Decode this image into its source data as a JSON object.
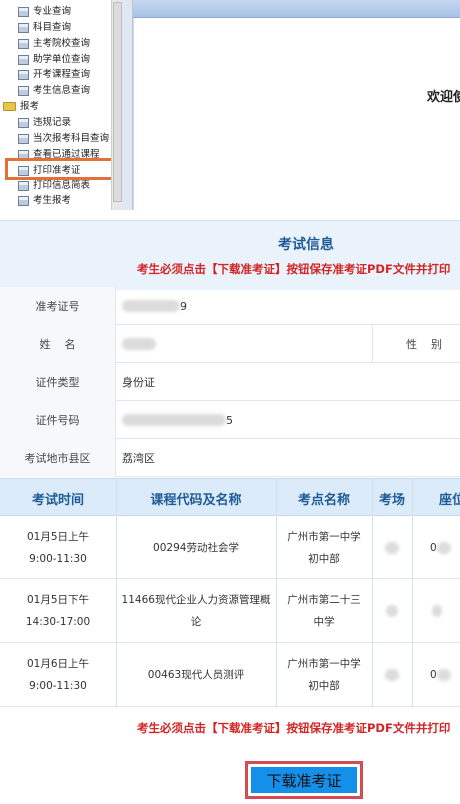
{
  "nav_tree": {
    "items_top": [
      "专业查询",
      "科目查询",
      "主考院校查询",
      "助学单位查询",
      "开考课程查询",
      "考生信息查询"
    ],
    "folder_label": "报考",
    "items_bottom": [
      "违规记录",
      "当次报考科目查询",
      "查看已通过课程",
      "打印准考证",
      "打印信息简表",
      "考生报考"
    ],
    "highlighted": "打印准考证"
  },
  "welcome_text": "欢迎使",
  "exam_info": {
    "heading": "考试信息",
    "notice": "考生必须点击【下载准考证】按钮保存准考证PDF文件并打印",
    "fields": {
      "ticket_no_label": "准考证号",
      "ticket_no_value_tail": "9",
      "name_label": "姓    名",
      "gender_label": "性    别",
      "id_type_label": "证件类型",
      "id_type_value": "身份证",
      "id_no_label": "证件号码",
      "id_no_value_tail": "5",
      "district_label": "考试地市县区",
      "district_value": "荔湾区"
    }
  },
  "exam_table": {
    "headers": [
      "考试时间",
      "课程代码及名称",
      "考点名称",
      "考场",
      "座位"
    ],
    "rows": [
      {
        "date": "01月5日上午",
        "time": "9:00-11:30",
        "course": "00294劳动社会学",
        "site_line1": "广州市第一中学",
        "site_line2": "初中部",
        "seat_prefix": "0"
      },
      {
        "date": "01月5日下午",
        "time": "14:30-17:00",
        "course_line1": "11466现代企业人力资源管理概",
        "course_line2": "论",
        "site_line1": "广州市第二十三",
        "site_line2": "中学",
        "seat_prefix": ""
      },
      {
        "date": "01月6日上午",
        "time": "9:00-11:30",
        "course": "00463现代人员测评",
        "site_line1": "广州市第一中学",
        "site_line2": "初中部",
        "seat_prefix": "0"
      }
    ]
  },
  "bottom_notice": "考生必须点击【下载准考证】按钮保存准考证PDF文件并打印",
  "download_button_label": "下载准考证",
  "colors": {
    "accent_blue": "#1f5c99",
    "notice_red": "#d22525",
    "highlight_orange": "#e27038",
    "button_blue": "#1590ea",
    "button_outline": "#d64a55"
  }
}
